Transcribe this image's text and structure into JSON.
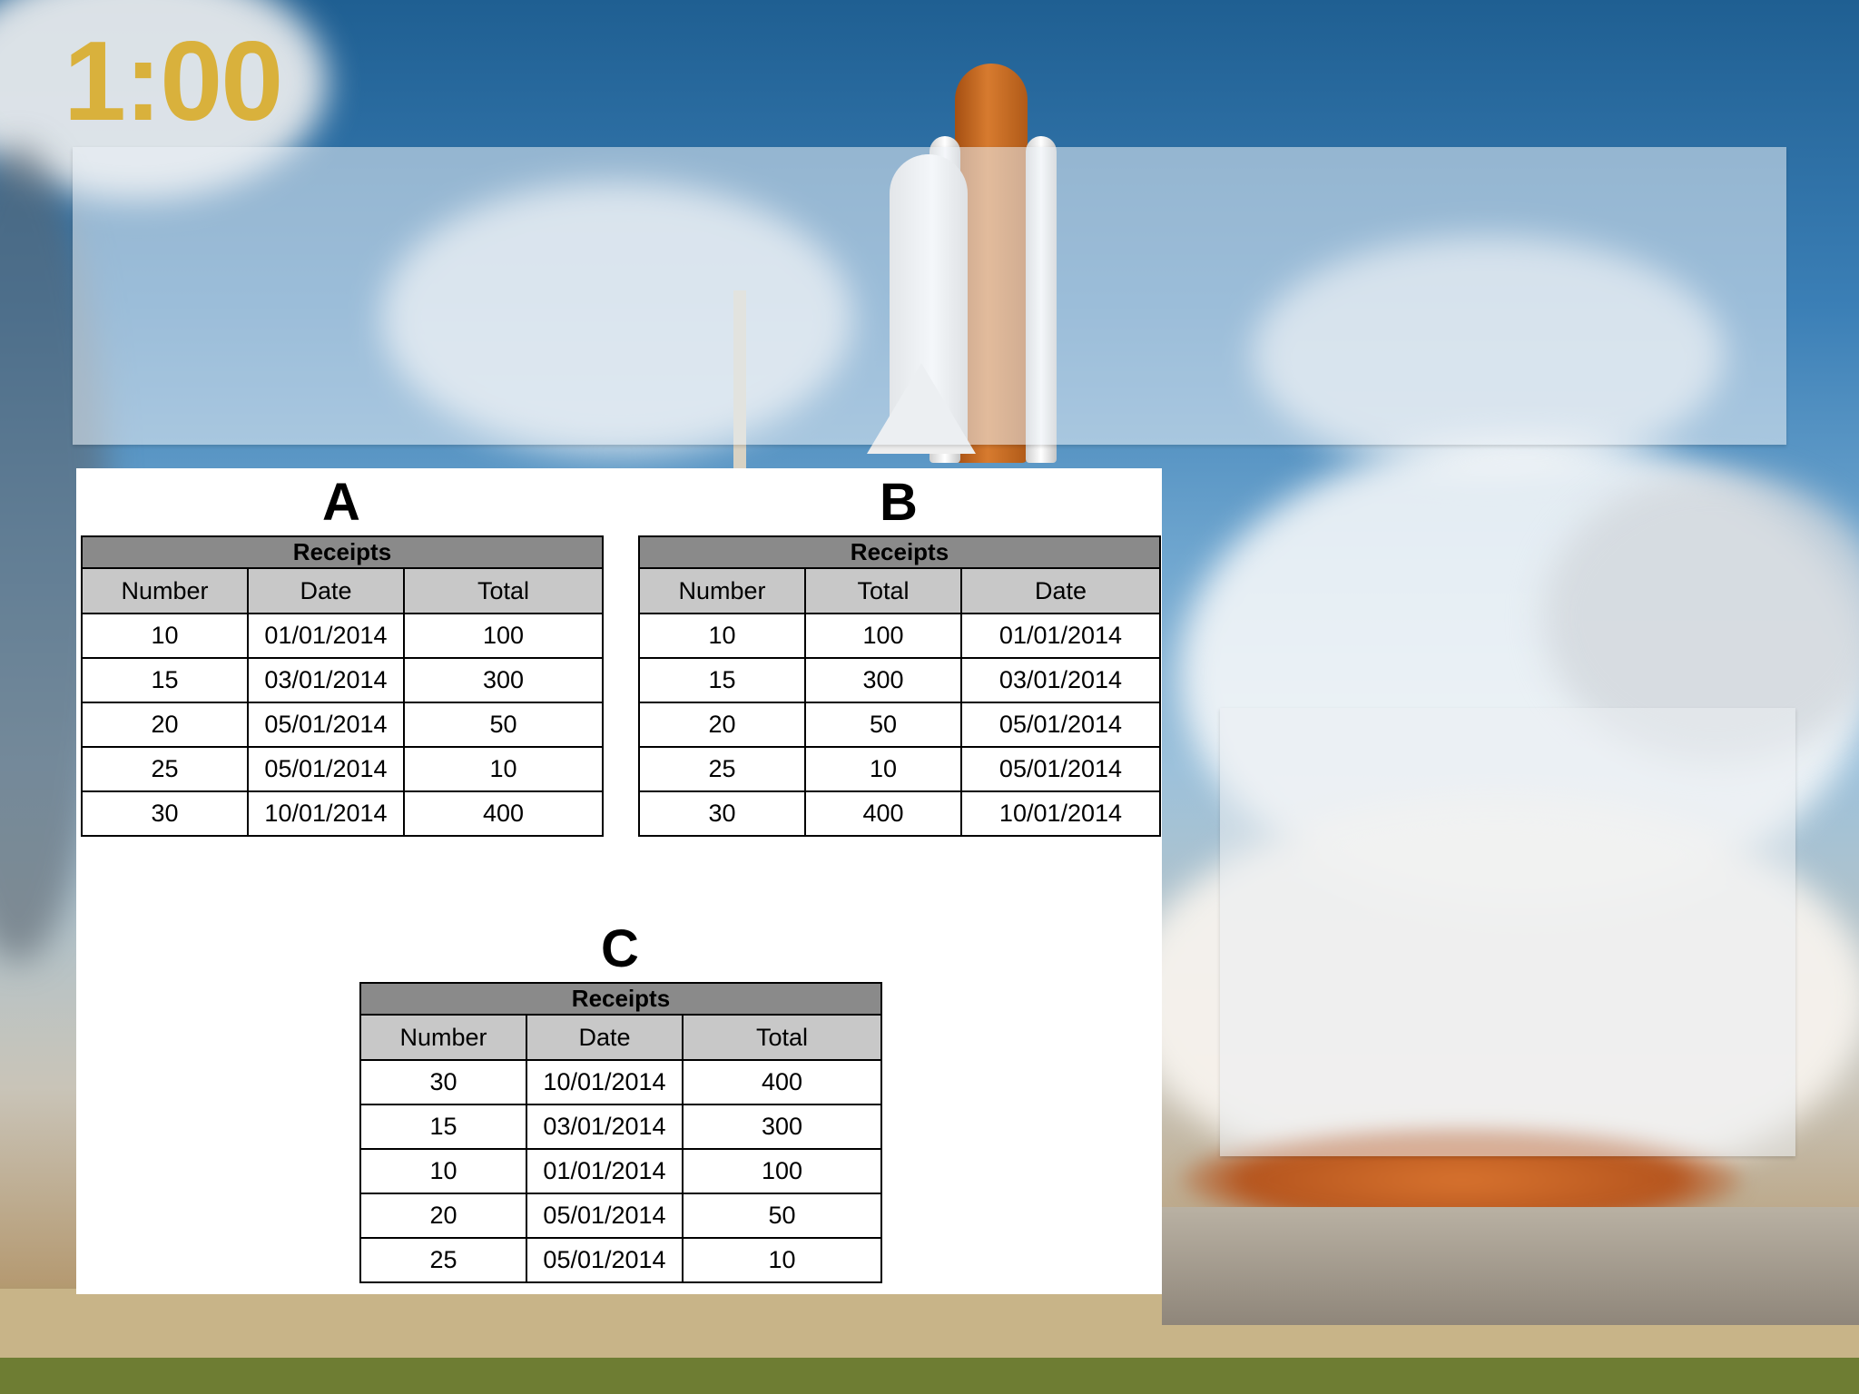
{
  "timer": "1:00",
  "tables": [
    {
      "letter": "A",
      "caption": "Receipts",
      "columns": [
        "Number",
        "Date",
        "Total"
      ],
      "rows": [
        [
          "10",
          "01/01/2014",
          "100"
        ],
        [
          "15",
          "03/01/2014",
          "300"
        ],
        [
          "20",
          "05/01/2014",
          "50"
        ],
        [
          "25",
          "05/01/2014",
          "10"
        ],
        [
          "30",
          "10/01/2014",
          "400"
        ]
      ]
    },
    {
      "letter": "B",
      "caption": "Receipts",
      "columns": [
        "Number",
        "Total",
        "Date"
      ],
      "rows": [
        [
          "10",
          "100",
          "01/01/2014"
        ],
        [
          "15",
          "300",
          "03/01/2014"
        ],
        [
          "20",
          "50",
          "05/01/2014"
        ],
        [
          "25",
          "10",
          "05/01/2014"
        ],
        [
          "30",
          "400",
          "10/01/2014"
        ]
      ]
    },
    {
      "letter": "C",
      "caption": "Receipts",
      "columns": [
        "Number",
        "Date",
        "Total"
      ],
      "rows": [
        [
          "30",
          "10/01/2014",
          "400"
        ],
        [
          "15",
          "03/01/2014",
          "300"
        ],
        [
          "10",
          "01/01/2014",
          "100"
        ],
        [
          "20",
          "05/01/2014",
          "50"
        ],
        [
          "25",
          "05/01/2014",
          "10"
        ]
      ]
    }
  ],
  "colors": {
    "timer": "#d9b13c",
    "caption_bg": "#8a8a8a",
    "header_bg": "#c8c8c8"
  }
}
